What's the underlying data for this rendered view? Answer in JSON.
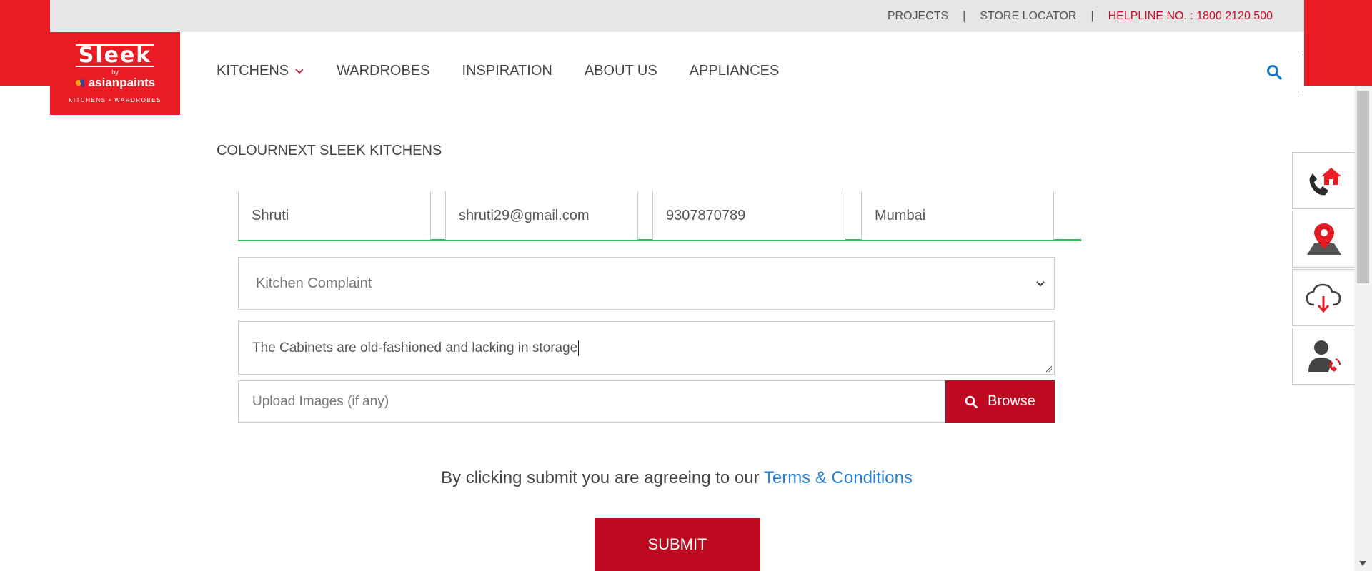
{
  "colors": {
    "brand_red": "#ec1c24",
    "button_red": "#be0a20",
    "link_blue": "#2a7fd4",
    "valid_green": "#2ebd59",
    "helpline": "#c8102e"
  },
  "topbar": {
    "projects": "PROJECTS",
    "sep": "|",
    "store_locator": "STORE LOCATOR",
    "helpline": "HELPLINE NO. : 1800 2120 500"
  },
  "logo": {
    "word": "Sleek",
    "by": "by",
    "brand": "asianpaints",
    "tagline": "KITCHENS • WARDROBES"
  },
  "nav": {
    "items": [
      "KITCHENS",
      "WARDROBES",
      "INSPIRATION",
      "ABOUT US",
      "APPLIANCES"
    ]
  },
  "section": {
    "title": "COLOURNEXT SLEEK KITCHENS"
  },
  "form": {
    "name": "Shruti",
    "email": "shruti29@gmail.com",
    "phone": "9307870789",
    "city": "Mumbai",
    "category": "Kitchen Complaint",
    "message": "The Cabinets are old-fashioned and lacking in storage",
    "upload_placeholder": "Upload Images (if any)",
    "browse_label": "Browse",
    "agree_text": "By clicking submit you are agreeing to our",
    "terms_link": "Terms & Conditions",
    "submit_label": "SUBMIT"
  },
  "side_panel": {
    "icons": [
      "call-home-icon",
      "location-pin-icon",
      "cloud-download-icon",
      "contact-support-icon"
    ]
  }
}
